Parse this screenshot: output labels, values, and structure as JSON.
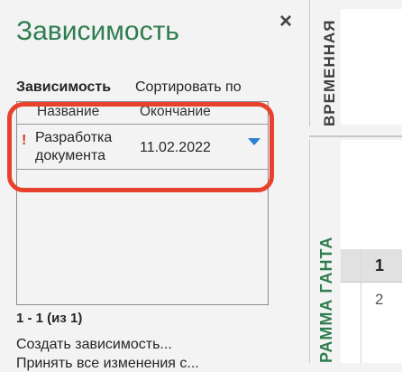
{
  "pane": {
    "title": "Зависимость",
    "close_glyph": "×",
    "dependency_label": "Зависимость",
    "sort_label": "Сортировать по",
    "grid": {
      "columns": [
        "Название",
        "Окончание"
      ],
      "rows": [
        {
          "indicator": "!",
          "name": "Разработка документа",
          "end": "11.02.2022"
        }
      ]
    },
    "count": "1 - 1 (из 1)",
    "create_link": "Создать зависимость...",
    "next_link": "Принять все изменения с..."
  },
  "side": {
    "timeline_tab": "ВРЕМЕННАЯ",
    "gantt_tab": "РАММА ГАНТА",
    "row_numbers": [
      "1",
      "2"
    ]
  },
  "colors": {
    "accent_green": "#2e7d4f",
    "highlight_red": "#e8422f",
    "dropdown_blue": "#2f7fd1"
  }
}
